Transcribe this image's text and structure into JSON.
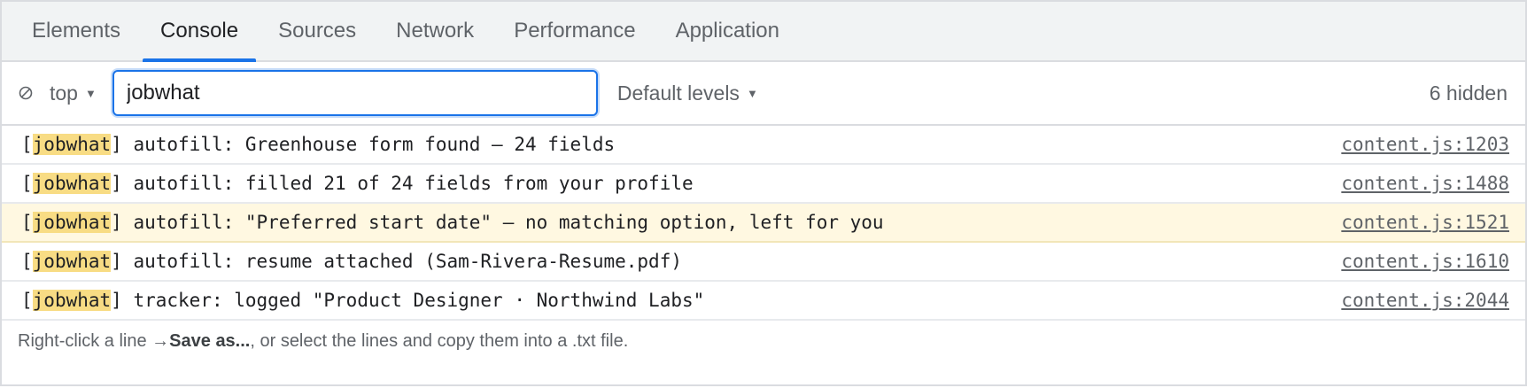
{
  "tabs": [
    {
      "label": "Elements",
      "active": false
    },
    {
      "label": "Console",
      "active": true
    },
    {
      "label": "Sources",
      "active": false
    },
    {
      "label": "Network",
      "active": false
    },
    {
      "label": "Performance",
      "active": false
    },
    {
      "label": "Application",
      "active": false
    }
  ],
  "toolbar": {
    "clear_icon": "no-entry-icon",
    "context": "top",
    "filter_value": "jobwhat",
    "levels": "Default levels",
    "hidden_count": "6 hidden"
  },
  "logs": [
    {
      "tag": "jobwhat",
      "text": "autofill: Greenhouse form found — 24 fields",
      "source": "content.js:1203",
      "level": "info"
    },
    {
      "tag": "jobwhat",
      "text": "autofill: filled 21 of 24 fields from your profile",
      "source": "content.js:1488",
      "level": "info"
    },
    {
      "tag": "jobwhat",
      "text": "autofill: \"Preferred start date\" — no matching option, left for you",
      "source": "content.js:1521",
      "level": "warning"
    },
    {
      "tag": "jobwhat",
      "text": "autofill: resume attached (Sam-Rivera-Resume.pdf)",
      "source": "content.js:1610",
      "level": "info"
    },
    {
      "tag": "jobwhat",
      "text": "tracker: logged \"Product Designer · Northwind Labs\"",
      "source": "content.js:2044",
      "level": "info"
    }
  ],
  "hint": {
    "prefix": "Right-click a line → ",
    "bold": "Save as...",
    "suffix": ", or select the lines and copy them into a .txt file."
  },
  "colors": {
    "accent": "#1a73e8",
    "highlight": "#f8dc84",
    "warning_bg": "#fff8e1"
  }
}
